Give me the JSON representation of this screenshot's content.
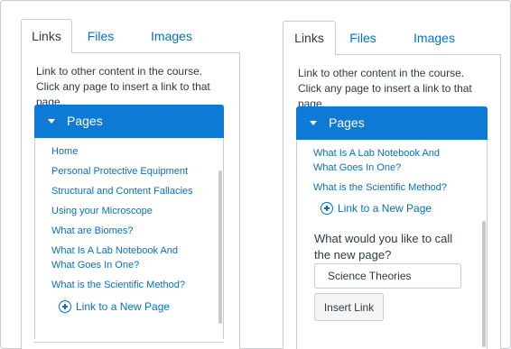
{
  "tabs": [
    "Links",
    "Files",
    "Images"
  ],
  "intro": "Link to other content in the course. Click any page to insert a link to that page.",
  "section_title": "Pages",
  "left_links": [
    "Home",
    "Personal Protective Equipment",
    "Structural and Content Fallacies",
    "Using your Microscope",
    "What are Biomes?",
    "What Is A Lab Notebook And What Goes In One?",
    "What is the Scientific Method?"
  ],
  "right_links": [
    "What Is A Lab Notebook And What Goes In One?",
    "What is the Scientific Method?"
  ],
  "new_page_label": "Link to a New Page",
  "new_page_question": "What would you like to call the new page?",
  "new_page_input_value": "Science Theories",
  "insert_button_label": "Insert Link",
  "colors": {
    "accent": "#0d7ad6",
    "link": "#0770c4",
    "highlight": "#a01a1f"
  }
}
